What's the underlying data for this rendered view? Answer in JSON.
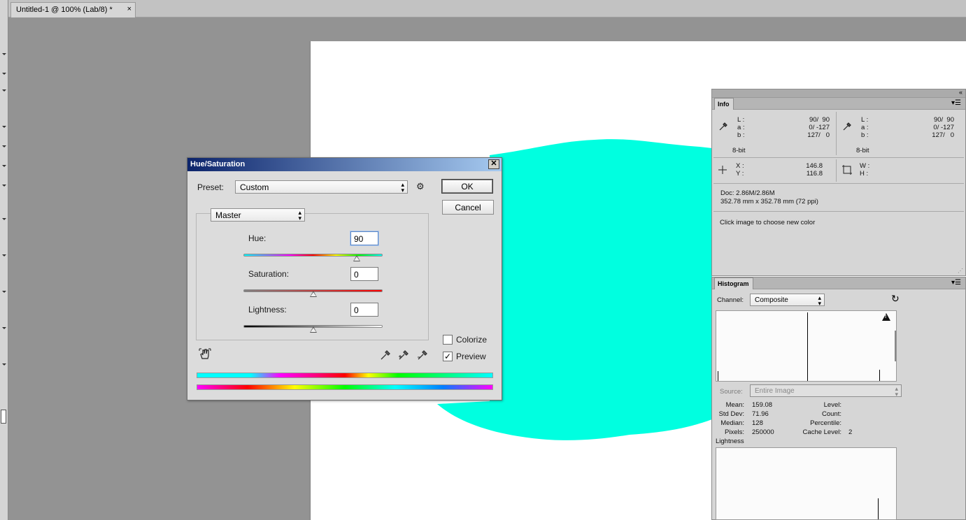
{
  "document_tab": {
    "title": "Untitled-1 @ 100% (Lab/8) *",
    "close": "×"
  },
  "dialog": {
    "title": "Hue/Saturation",
    "close": "✕",
    "preset_label": "Preset:",
    "preset_value": "Custom",
    "ok_label": "OK",
    "cancel_label": "Cancel",
    "channel_value": "Master",
    "hue": {
      "label": "Hue:",
      "value": "90",
      "slider_fraction": 0.815
    },
    "saturation": {
      "label": "Saturation:",
      "value": "0",
      "slider_fraction": 0.5
    },
    "lightness": {
      "label": "Lightness:",
      "value": "0",
      "slider_fraction": 0.5
    },
    "colorize_label": "Colorize",
    "colorize_checked": false,
    "preview_label": "Preview",
    "preview_checked": true
  },
  "info_panel": {
    "tab": "Info",
    "lab1": {
      "l_label": "L :",
      "a_label": "a :",
      "b_label": "b :",
      "l_value": "90/  90",
      "a_value": "0/ -127",
      "b_value": "127/   0",
      "depth": "8-bit"
    },
    "lab2": {
      "l_label": "L :",
      "a_label": "a :",
      "b_label": "b :",
      "l_value": "90/  90",
      "a_value": "0/ -127",
      "b_value": "127/   0",
      "depth": "8-bit"
    },
    "xy": {
      "x_label": "X :",
      "y_label": "Y :",
      "x_value": "146.8",
      "y_value": "116.8"
    },
    "wh": {
      "w_label": "W :",
      "h_label": "H :"
    },
    "doc": "Doc: 2.86M/2.86M",
    "dimensions": "352.78 mm x 352.78 mm (72 ppi)",
    "hint": "Click image to choose new color"
  },
  "histogram_panel": {
    "tab": "Histogram",
    "channel_label": "Channel:",
    "channel_value": "Composite",
    "source_label": "Source:",
    "source_value": "Entire Image",
    "stats": {
      "mean_label": "Mean:",
      "mean": "159.08",
      "std_label": "Std Dev:",
      "std": "71.96",
      "median_label": "Median:",
      "median": "128",
      "pixels_label": "Pixels:",
      "pixels": "250000",
      "level_label": "Level:",
      "count_label": "Count:",
      "percentile_label": "Percentile:",
      "cache_label": "Cache Level:",
      "cache": "2"
    },
    "sub_channel": "Lightness",
    "warning_icon": "!"
  },
  "colors": {
    "cyan_shape": "#00ffe0",
    "title_start": "#0c246b",
    "title_end": "#a6caf0"
  }
}
